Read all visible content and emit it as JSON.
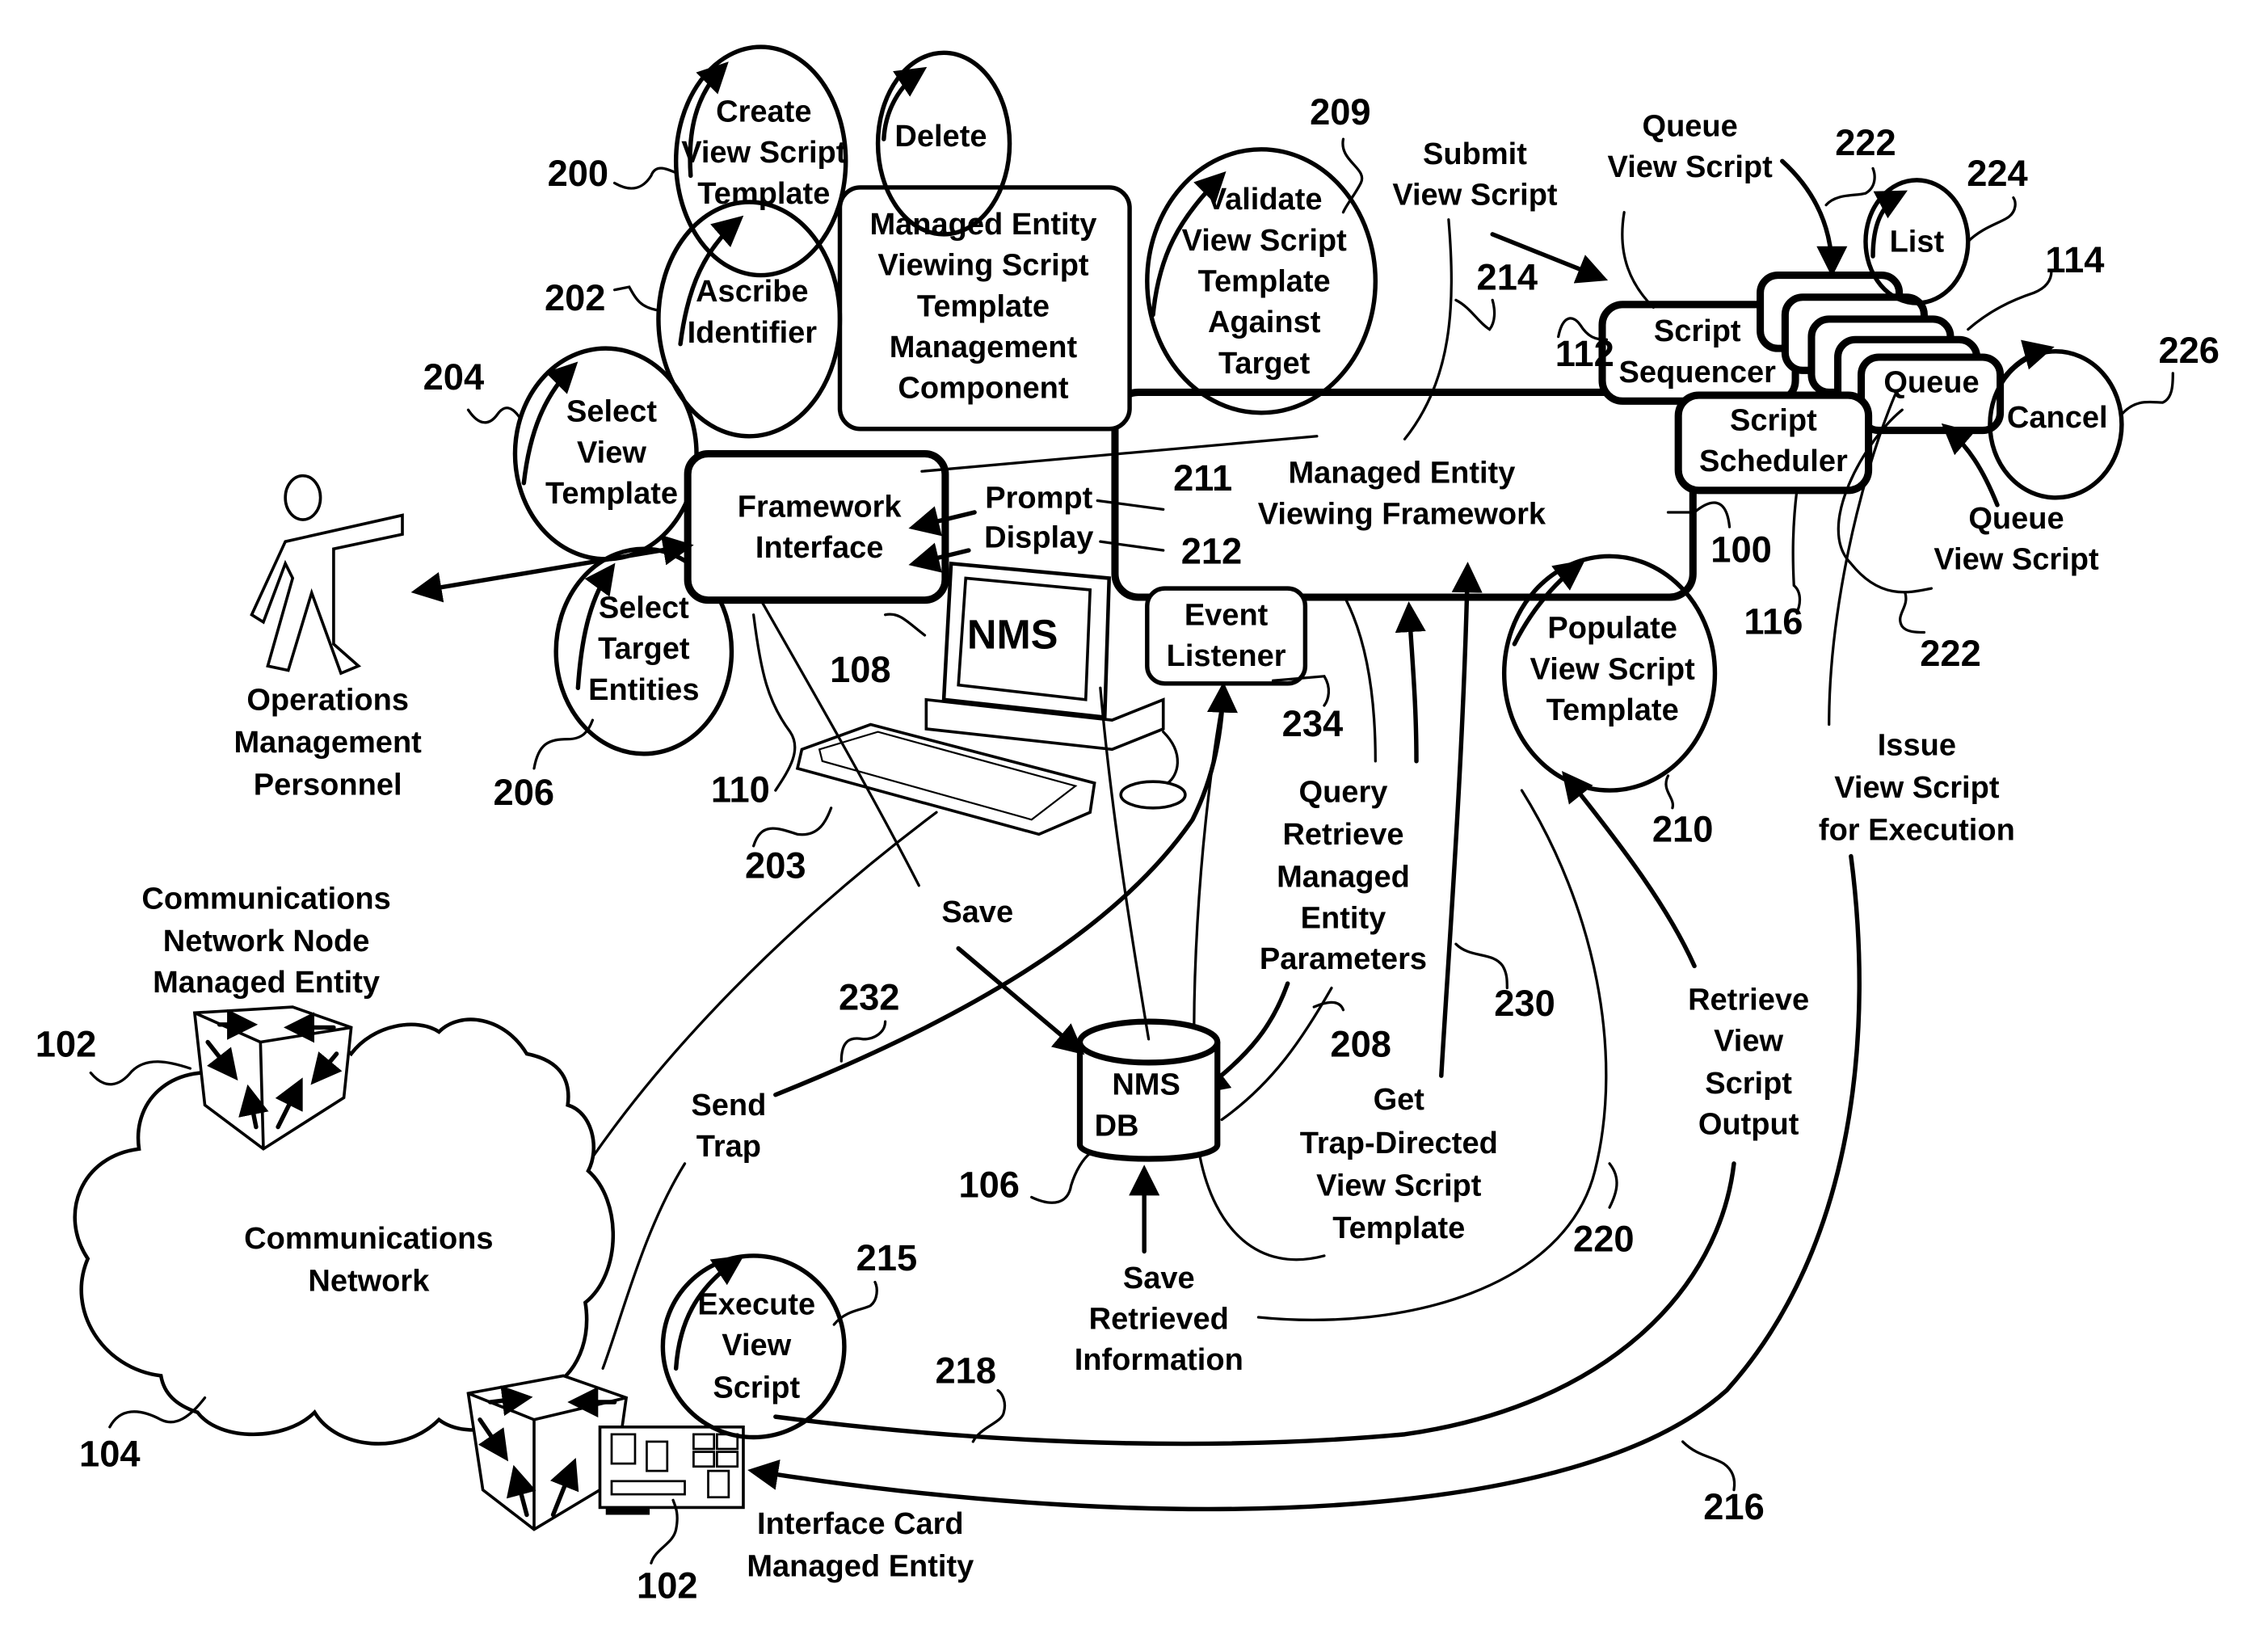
{
  "figure": {
    "components": {
      "framework": {
        "label": [
          "Managed Entity",
          "Viewing Framework"
        ],
        "ref": "100"
      },
      "template_mgmt": {
        "label": [
          "Managed Entity",
          "Viewing Script",
          "Template",
          "Management",
          "Component"
        ]
      },
      "framework_interface": {
        "label": [
          "Framework",
          "Interface"
        ],
        "ref": "110"
      },
      "script_sequencer": {
        "label": [
          "Script",
          "Sequencer"
        ],
        "ref": "112"
      },
      "script_scheduler": {
        "label": [
          "Script",
          "Scheduler"
        ],
        "ref": "116"
      },
      "queue": {
        "label": "Queue",
        "ref": "114"
      },
      "event_listener": {
        "label": [
          "Event",
          "Listener"
        ],
        "ref": "234"
      },
      "nms_terminal": {
        "label": "NMS",
        "ref": "108"
      },
      "nms_db": {
        "label": [
          "NMS",
          "DB"
        ],
        "ref": "106"
      },
      "network": {
        "label": [
          "Communications",
          "Network"
        ],
        "ref": "104"
      },
      "network_node": {
        "label": [
          "Communications",
          "Network Node",
          "Managed Entity"
        ],
        "ref": "102"
      },
      "interface_card": {
        "label": [
          "Interface Card",
          "Managed Entity"
        ],
        "ref": "102"
      },
      "personnel": {
        "label": [
          "Operations",
          "Management",
          "Personnel"
        ]
      }
    },
    "operations": {
      "create": {
        "label": [
          "Create",
          "View Script",
          "Template"
        ],
        "ref": "200"
      },
      "delete": {
        "label": "Delete"
      },
      "ascribe": {
        "label": [
          "Ascribe",
          "Identifier"
        ],
        "ref": "202"
      },
      "select_view": {
        "label": [
          "Select",
          "View",
          "Template"
        ],
        "ref": "204"
      },
      "select_target": {
        "label": [
          "Select",
          "Target",
          "Entities"
        ],
        "ref": "206"
      },
      "validate": {
        "label": [
          "Validate",
          "View Script",
          "Template",
          "Against",
          "Target"
        ],
        "ref": "209"
      },
      "populate": {
        "label": [
          "Populate",
          "View Script",
          "Template"
        ],
        "ref": "210"
      },
      "execute": {
        "label": [
          "Execute",
          "View",
          "Script"
        ],
        "ref": "215"
      },
      "list": {
        "label": "List",
        "ref": "224"
      },
      "cancel": {
        "label": "Cancel",
        "ref": "226"
      }
    },
    "flows": {
      "prompt": "Prompt",
      "display": "Display",
      "prompt_ref": "211",
      "display_ref": "212",
      "save": "Save",
      "save_ref": "203",
      "submit": [
        "Submit",
        "View Script"
      ],
      "submit_ref": "214",
      "queue_top": [
        "Queue",
        "View Script"
      ],
      "queue_top_ref": "222",
      "queue_right": [
        "Queue",
        "View Script"
      ],
      "queue_right_ref": "222",
      "issue": [
        "Issue",
        "View Script",
        "for Execution"
      ],
      "issue_ref": "216",
      "query": [
        "Query",
        "Retrieve",
        "Managed",
        "Entity",
        "Parameters"
      ],
      "query_ref": "208",
      "get_trap": [
        "Get",
        "Trap-Directed",
        "View Script",
        "Template"
      ],
      "get_trap_ref": "230",
      "retrieve_output": [
        "Retrieve",
        "View",
        "Script",
        "Output"
      ],
      "retrieve_output_ref": "220",
      "save_retrieved": [
        "Save",
        "Retrieved",
        "Information"
      ],
      "save_retrieved_ref": "218",
      "send_trap": [
        "Send",
        "Trap"
      ],
      "send_trap_ref": "232"
    }
  }
}
